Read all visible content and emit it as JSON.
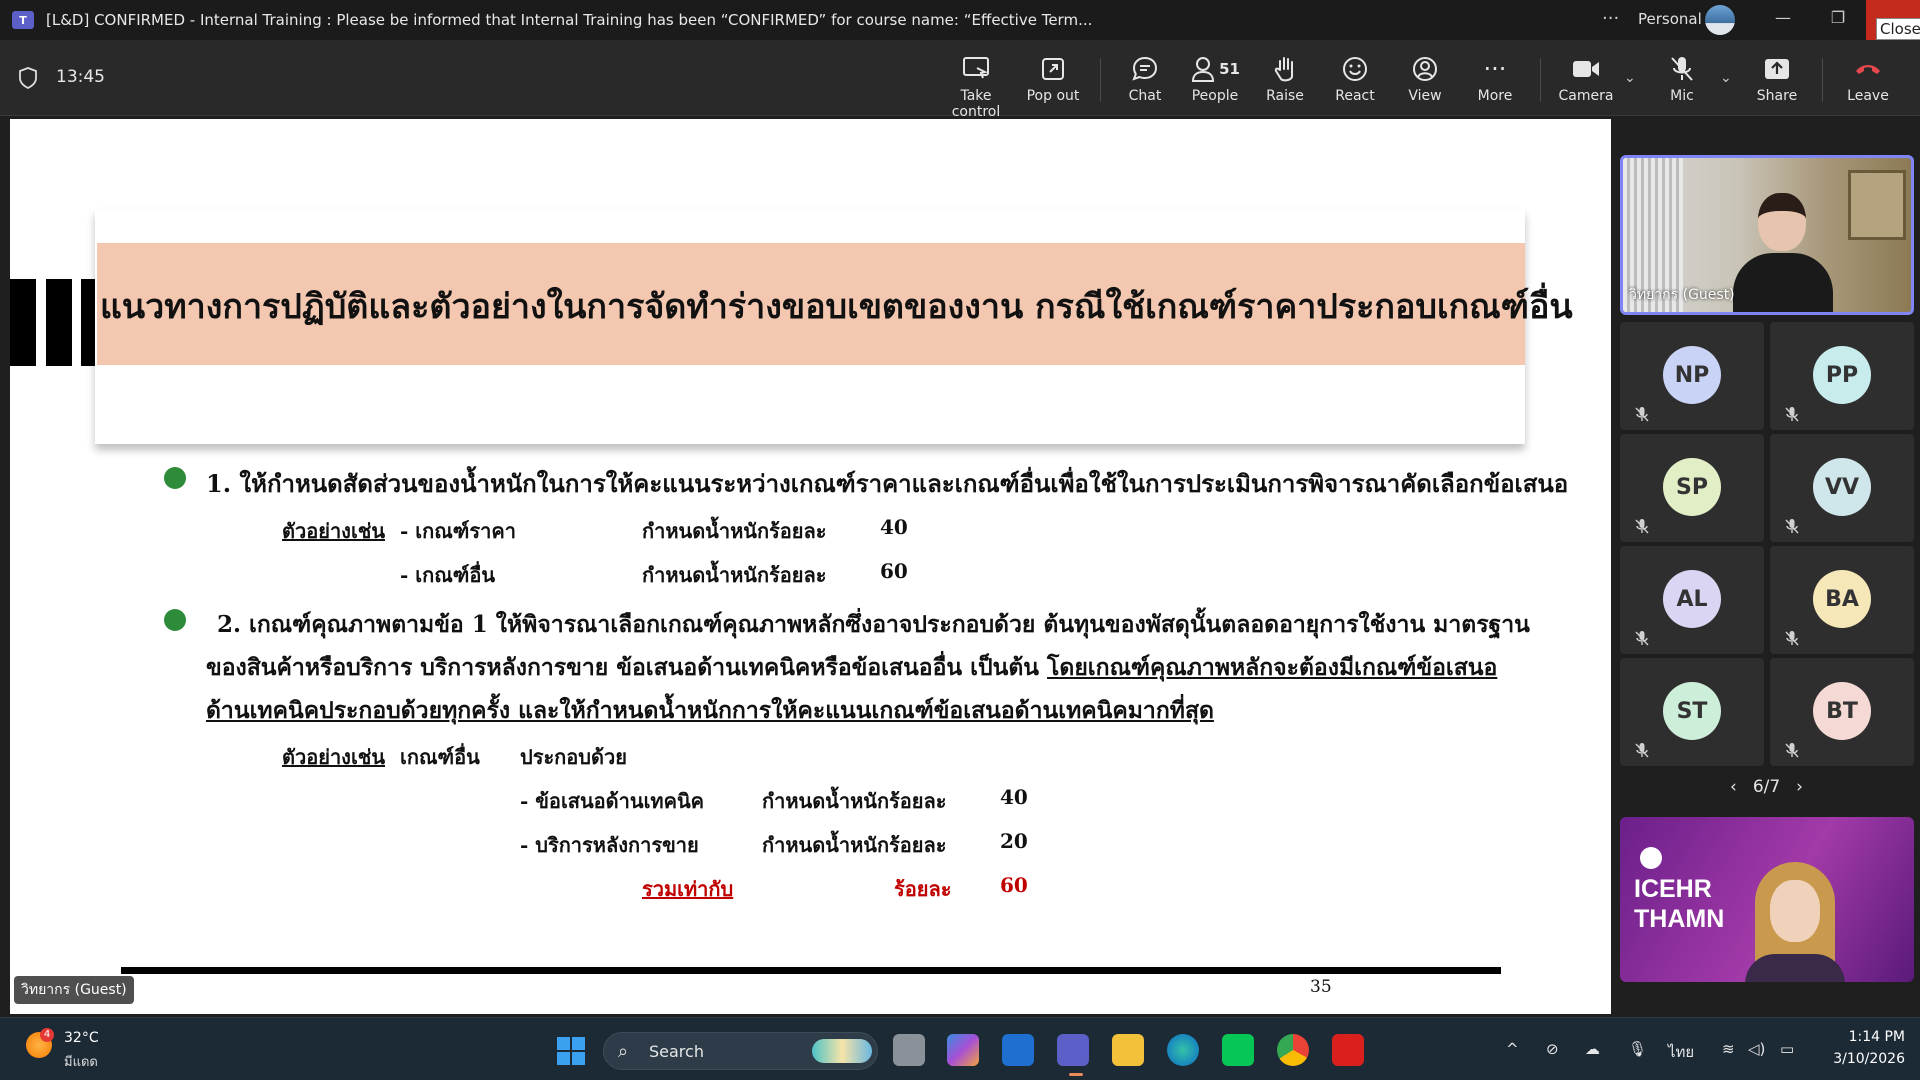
{
  "window": {
    "title": "[L&D] CONFIRMED - Internal Training : Please be informed that Internal Training has been “CONFIRMED” for course name: “Effective Term...",
    "profile_label": "Personal",
    "close_tooltip": "Close"
  },
  "meeting": {
    "timer": "13:45",
    "toolbar": {
      "take_control": "Take control",
      "pop_out": "Pop out",
      "chat": "Chat",
      "people": "People",
      "people_count": "51",
      "raise": "Raise",
      "react": "React",
      "view": "View",
      "more": "More",
      "camera": "Camera",
      "mic": "Mic",
      "share": "Share",
      "leave": "Leave"
    }
  },
  "slide": {
    "header": "แนวทางการปฏิบัติและตัวอย่างในการจัดทำร่างขอบเขตของงาน กรณีใช้เกณฑ์ราคาประกอบเกณฑ์อื่น",
    "item1": "1. ให้กำหนดสัดส่วนของน้ำหนักในการให้คะแนนระหว่างเกณฑ์ราคาและเกณฑ์อื่นเพื่อใช้ในการประเมินการพิจารณาคัดเลือกข้อเสนอ",
    "ex1_label": "ตัวอย่างเช่น",
    "ex1_row1_name": "- เกณฑ์ราคา",
    "ex1_row1_desc": "กำหนดน้ำหนักร้อยละ",
    "ex1_row1_value": "40",
    "ex1_row2_name": "- เกณฑ์อื่น",
    "ex1_row2_desc": "กำหนดน้ำหนักร้อยละ",
    "ex1_row2_value": "60",
    "item2_line1": "2. เกณฑ์คุณภาพตามข้อ 1 ให้พิจารณาเลือกเกณฑ์คุณภาพหลักซึ่งอาจประกอบด้วย ต้นทุนของพัสดุนั้นตลอดอายุการใช้งาน มาตรฐาน",
    "item2_line2_a": "ของสินค้าหรือบริการ บริการหลังการขาย ข้อเสนอด้านเทคนิคหรือข้อเสนออื่น เป็นต้น ",
    "item2_line2_b": "โดยเกณฑ์คุณภาพหลักจะต้องมีเกณฑ์ข้อเสนอ",
    "item2_line3": "ด้านเทคนิคประกอบด้วยทุกครั้ง และให้กำหนดน้ำหนักการให้คะแนนเกณฑ์ข้อเสนอด้านเทคนิคมากที่สุด",
    "ex2_label": "ตัวอย่างเช่น",
    "ex2_other": "เกณฑ์อื่น",
    "ex2_consists": "ประกอบด้วย",
    "ex2_row1_name": "- ข้อเสนอด้านเทคนิค",
    "ex2_row1_desc": "กำหนดน้ำหนักร้อยละ",
    "ex2_row1_value": "40",
    "ex2_row2_name": "- บริการหลังการขาย",
    "ex2_row2_desc": "กำหนดน้ำหนักร้อยละ",
    "ex2_row2_value": "20",
    "total_label": "รวมเท่ากับ",
    "total_desc": "ร้อยละ",
    "total_value": "60",
    "page_number": "35"
  },
  "presenter_label": "วิทยากร (Guest)",
  "participants": {
    "main_video_label": "วิทยากร (Guest)",
    "tiles": [
      {
        "initials": "NP",
        "color": "#c9d3f5"
      },
      {
        "initials": "PP",
        "color": "#c8ecec"
      },
      {
        "initials": "SP",
        "color": "#e2efc6"
      },
      {
        "initials": "VV",
        "color": "#cfe7ea"
      },
      {
        "initials": "AL",
        "color": "#dad5f2"
      },
      {
        "initials": "BA",
        "color": "#f6e7b8"
      },
      {
        "initials": "ST",
        "color": "#cdeed9"
      },
      {
        "initials": "BT",
        "color": "#f5d9d4"
      }
    ],
    "pager": "6/7",
    "share_video_line1": "ICEHR",
    "share_video_line2": "THAMN"
  },
  "taskbar": {
    "weather_badge": "4",
    "temperature": "32°C",
    "weather_desc": "มีแดด",
    "search_label": "Search",
    "language": "ไทย",
    "time": "1:14 PM",
    "date": "3/10/2026"
  }
}
